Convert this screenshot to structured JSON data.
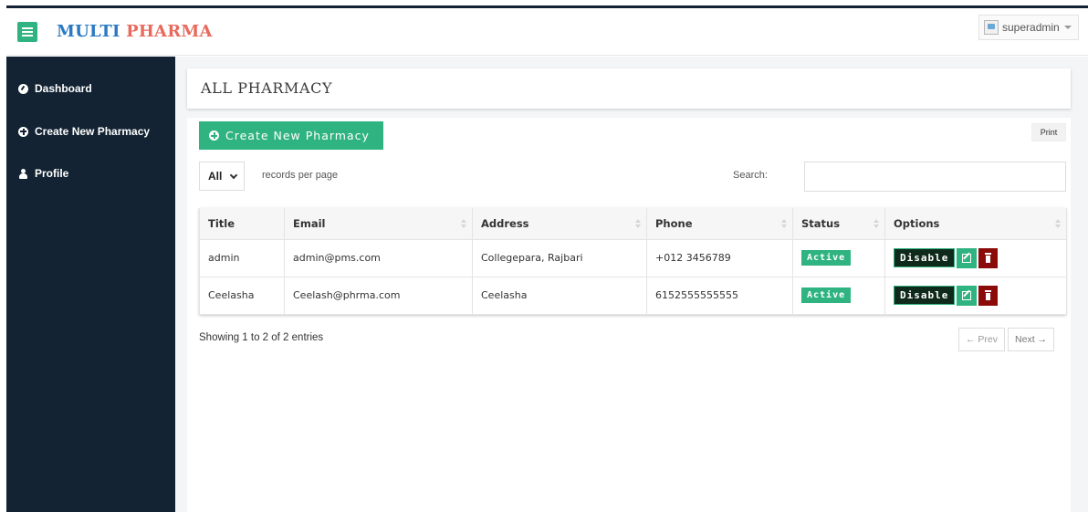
{
  "header": {
    "brand_part1": "MULTI",
    "brand_part2": "PHARMA",
    "username": "superadmin",
    "brand_colors": {
      "part1": "#2b79c2",
      "part2": "#e86a5d"
    }
  },
  "sidebar": {
    "items": [
      {
        "label": "Dashboard",
        "icon": "dashboard-icon"
      },
      {
        "label": "Create New Pharmacy",
        "icon": "plus-circle-icon"
      },
      {
        "label": "Profile",
        "icon": "user-icon"
      }
    ]
  },
  "page": {
    "title": "ALL PHARMACY",
    "create_button": "Create New Pharmacy",
    "print_button": "Print",
    "length_select": "All",
    "length_label": "records per page",
    "search_label": "Search:",
    "search_value": ""
  },
  "table": {
    "columns": [
      "Title",
      "Email",
      "Address",
      "Phone",
      "Status",
      "Options"
    ],
    "rows": [
      {
        "title": "admin",
        "email": "admin@pms.com",
        "address": "Collegepara, Rajbari",
        "phone": "+012 3456789",
        "status": "Active",
        "action": "Disable"
      },
      {
        "title": "Ceelasha",
        "email": "Ceelash@phrma.com",
        "address": "Ceelasha",
        "phone": "6152555555555",
        "status": "Active",
        "action": "Disable"
      }
    ]
  },
  "footer": {
    "info": "Showing 1 to 2 of 2 entries",
    "prev": "← Prev",
    "next": "Next →"
  },
  "colors": {
    "accent": "#2fb380",
    "sidebar": "#132333",
    "danger": "#8b0a0a"
  }
}
